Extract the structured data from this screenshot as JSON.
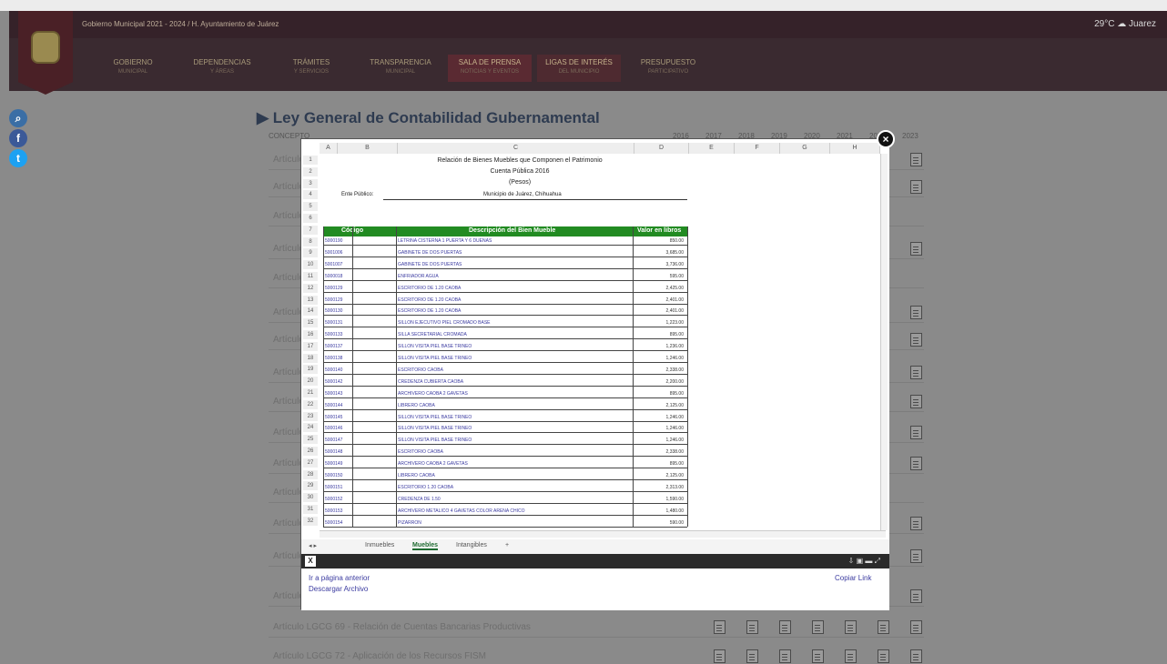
{
  "header": {
    "title": "Gobierno Municipal 2021 - 2024 / H. Ayuntamiento de Juárez",
    "weather": "29°C",
    "city": "Juarez",
    "nav": [
      {
        "label": "GOBIERNO",
        "sub": "MUNICIPAL"
      },
      {
        "label": "DEPENDENCIAS",
        "sub": "Y ÁREAS"
      },
      {
        "label": "TRÁMITES",
        "sub": "Y SERVICIOS"
      },
      {
        "label": "TRANSPARENCIA",
        "sub": "MUNICIPAL"
      },
      {
        "label": "SALA DE PRENSA",
        "sub": "NOTICIAS Y EVENTOS"
      },
      {
        "label": "LIGAS DE INTERÉS",
        "sub": "DEL MUNICIPIO"
      },
      {
        "label": "PRESUPUESTO",
        "sub": "PARTICIPATIVO"
      }
    ]
  },
  "page": {
    "title": "▶ Ley General de Contabilidad Gubernamental",
    "column_label": "CONCEPTO",
    "years": [
      "2016",
      "2017",
      "2018",
      "2019",
      "2020",
      "2021",
      "2022",
      "2023"
    ],
    "rows": [
      "Artículo",
      "Artículo",
      "Artículo",
      "Artículo",
      "Artículo",
      "Artículo",
      "Artículo",
      "Artículo",
      "Artículo",
      "Artículo",
      "Artículo",
      "Artículo",
      "Artículo",
      "Artículo",
      "Artículo",
      "Artículo LGCG 69 - Relación de Cuentas Bancarias Productivas",
      "Artículo LGCG 72 - Aplicación de los Recursos FISM"
    ]
  },
  "modal": {
    "close": "×",
    "sheet_columns": [
      "A",
      "B",
      "C",
      "D",
      "E",
      "F",
      "G",
      "H"
    ],
    "header_lines": [
      "Relación de Bienes Muebles que Componen el Patrimonio",
      "Cuenta Pública 2016",
      "(Pesos)"
    ],
    "ente_label": "Ente Público:",
    "ente_value": "Municipio de Juárez, Chihuahua",
    "table_headers": [
      "Código",
      "Descripción del Bien Mueble",
      "Valor en libros"
    ],
    "table_rows": [
      {
        "code": "5000190",
        "desc": "LETRINA CISTERNA 1 PUERTA Y 6 DUENAS",
        "value": "850.00"
      },
      {
        "code": "5001006",
        "desc": "GABINETE DE DOS PUERTAS",
        "value": "3,685.00"
      },
      {
        "code": "5001007",
        "desc": "GABINETE DE DOS PUERTAS",
        "value": "3,736.00"
      },
      {
        "code": "5000018",
        "desc": "ENFRIADOR AGUA",
        "value": "595.00"
      },
      {
        "code": "5000129",
        "desc": "ESCRITORIO DE 1.20 CAOBA",
        "value": "2,425.00"
      },
      {
        "code": "5000129",
        "desc": "ESCRITORIO DE 1.20 CAOBA",
        "value": "2,401.00"
      },
      {
        "code": "5000130",
        "desc": "ESCRITORIO DE 1.20 CAOBA",
        "value": "2,401.00"
      },
      {
        "code": "5000131",
        "desc": "SILLON EJECUTIVO PIEL CROMADO BASE",
        "value": "1,223.00"
      },
      {
        "code": "5000133",
        "desc": "SILLA SECRETARIAL CROMADA",
        "value": "895.00"
      },
      {
        "code": "5000137",
        "desc": "SILLON VISITA PIEL BASE TRINEO",
        "value": "1,236.00"
      },
      {
        "code": "5000138",
        "desc": "SILLON VISITA PIEL BASE TRINEO",
        "value": "1,246.00"
      },
      {
        "code": "5000140",
        "desc": "ESCRITORIO CAOBA",
        "value": "2,338.00"
      },
      {
        "code": "5000142",
        "desc": "CREDENZA CUBIERTA CAOBA",
        "value": "2,200.00"
      },
      {
        "code": "5000143",
        "desc": "ARCHIVERO CAOBA 2 GAVETAS",
        "value": "895.00"
      },
      {
        "code": "5000144",
        "desc": "LIBRERO CAOBA",
        "value": "2,125.00"
      },
      {
        "code": "5000145",
        "desc": "SILLON VISITA PIEL BASE TRINEO",
        "value": "1,246.00"
      },
      {
        "code": "5000146",
        "desc": "SILLON VISITA PIEL BASE TRINEO",
        "value": "1,246.00"
      },
      {
        "code": "5000147",
        "desc": "SILLON VISITA PIEL BASE TRINEO",
        "value": "1,246.00"
      },
      {
        "code": "5000148",
        "desc": "ESCRITORIO CAOBA",
        "value": "2,338.00"
      },
      {
        "code": "5000149",
        "desc": "ARCHIVERO CAOBA 2 GAVETAS",
        "value": "895.00"
      },
      {
        "code": "5000150",
        "desc": "LIBRERO CAOBA",
        "value": "2,125.00"
      },
      {
        "code": "5000151",
        "desc": "ESCRITORIO 1.20 CAOBA",
        "value": "2,313.00"
      },
      {
        "code": "5000152",
        "desc": "CREDENZA DE 1.50",
        "value": "1,590.00"
      },
      {
        "code": "5000153",
        "desc": "ARCHIVERO METALICO 4 GAVETAS COLOR ARENA CHICO",
        "value": "1,480.00"
      },
      {
        "code": "5000154",
        "desc": "PIZARRON",
        "value": "590.00"
      }
    ],
    "sheet_tabs": [
      "Inmuebles",
      "Muebles",
      "Intangibles"
    ],
    "active_tab": "Muebles",
    "footer": {
      "prev_page": "Ir a página anterior",
      "download": "Descargar Archivo",
      "copy_link": "Copiar Link"
    }
  }
}
